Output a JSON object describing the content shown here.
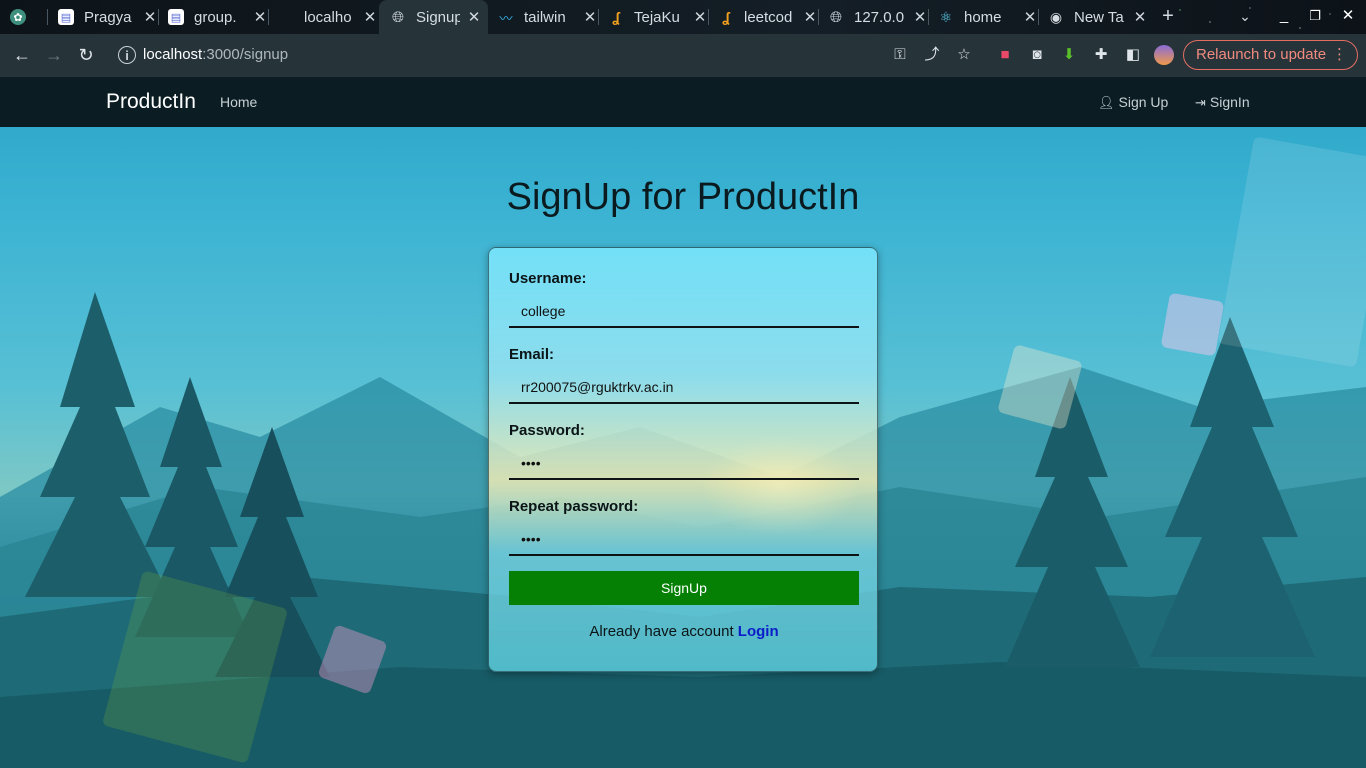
{
  "browser": {
    "tabs": [
      {
        "label": "",
        "icon": "openai-icon",
        "active": false
      },
      {
        "label": "Pragya",
        "icon": "doc-icon",
        "active": false
      },
      {
        "label": "group.",
        "icon": "doc-icon",
        "active": false
      },
      {
        "label": "localho",
        "icon": "",
        "active": false
      },
      {
        "label": "Signup",
        "icon": "globe-icon",
        "active": true
      },
      {
        "label": "tailwin",
        "icon": "tailwind-icon",
        "active": false
      },
      {
        "label": "TejaKu",
        "icon": "leetcode-icon",
        "active": false
      },
      {
        "label": "leetcod",
        "icon": "leetcode-icon",
        "active": false
      },
      {
        "label": "127.0.0",
        "icon": "globe-icon",
        "active": false
      },
      {
        "label": "home",
        "icon": "react-icon",
        "active": false
      },
      {
        "label": "New Ta",
        "icon": "chrome-icon",
        "active": false
      }
    ],
    "url_host": "localhost",
    "url_path": ":3000/signup",
    "relaunch_label": "Relaunch to update"
  },
  "navbar": {
    "brand": "ProductIn",
    "home": "Home",
    "signup": "Sign Up",
    "signin": "SignIn"
  },
  "form": {
    "title": "SignUp for ProductIn",
    "username_label": "Username:",
    "username_value": "college",
    "email_label": "Email:",
    "email_value": "rr200075@rguktrkv.ac.in",
    "password_label": "Password:",
    "password_value": "••••",
    "repeat_label": "Repeat password:",
    "repeat_value": "••••",
    "submit_label": "SignUp",
    "footer_text": "Already have account",
    "login_link": "Login"
  }
}
